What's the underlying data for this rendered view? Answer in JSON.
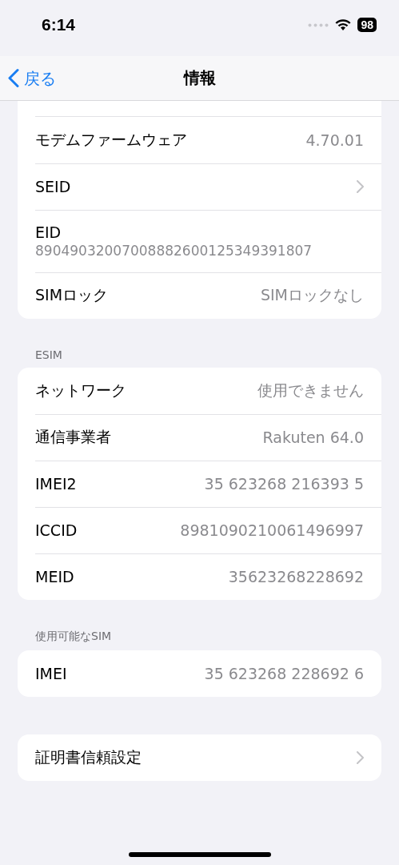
{
  "status_bar": {
    "time": "6:14",
    "battery": "98"
  },
  "nav": {
    "back": "戻る",
    "title": "情報"
  },
  "sections": [
    {
      "cut_top": true,
      "rows": [
        {
          "kind": "value",
          "label": "モデムファームウェア",
          "value": "4.70.01"
        },
        {
          "kind": "chevron",
          "label": "SEID"
        },
        {
          "kind": "stacked",
          "label": "EID",
          "value": "89049032007008882600125349391807"
        },
        {
          "kind": "value",
          "label": "SIMロック",
          "value": "SIMロックなし"
        }
      ]
    },
    {
      "header": "ESIM",
      "rows": [
        {
          "kind": "value",
          "label": "ネットワーク",
          "value": "使用できません"
        },
        {
          "kind": "value",
          "label": "通信事業者",
          "value": "Rakuten 64.0"
        },
        {
          "kind": "value",
          "label": "IMEI2",
          "value": "35 623268 216393 5"
        },
        {
          "kind": "value",
          "label": "ICCID",
          "value": "8981090210061496997"
        },
        {
          "kind": "value",
          "label": "MEID",
          "value": "35623268228692"
        }
      ]
    },
    {
      "header": "使用可能なSIM",
      "rows": [
        {
          "kind": "value",
          "label": "IMEI",
          "value": "35 623268 228692 6"
        }
      ]
    },
    {
      "rows": [
        {
          "kind": "chevron",
          "label": "証明書信頼設定"
        }
      ]
    }
  ]
}
